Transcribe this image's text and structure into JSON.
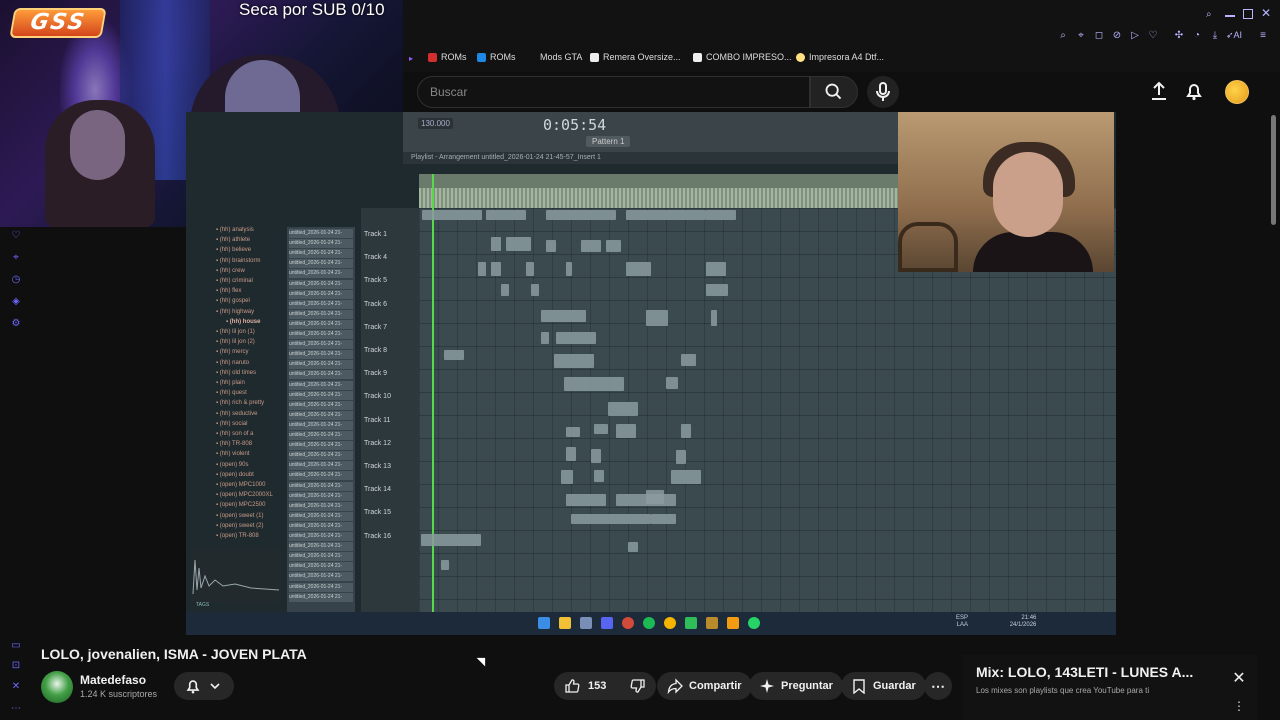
{
  "stream_overlay": {
    "logo_text": "GSS",
    "goal_text": "Seca por SUB 0/10"
  },
  "bookmarks": [
    {
      "label": "ROMs",
      "color": "#d32f2f"
    },
    {
      "label": "ROMs",
      "color": "#1e88e5"
    },
    {
      "label": "Mods GTA",
      "color": "#121212"
    },
    {
      "label": "Remera Oversize...",
      "color": "#fff"
    },
    {
      "label": "COMBO IMPRESO...",
      "color": "#fff"
    },
    {
      "label": "Impresora A4 Dtf...",
      "color": "#ffe082"
    }
  ],
  "header": {
    "search_placeholder": "Buscar",
    "browser_ai_label": "AI"
  },
  "icons": {
    "search": "search-icon",
    "mic": "mic-icon",
    "upload": "upload-icon",
    "bell": "bell-icon",
    "avatar": "avatar"
  },
  "fl_studio": {
    "tempo": "130.000",
    "time": "0:05:54",
    "pattern": "Pattern 1",
    "playlist_title": "Playlist - Arrangement  untitled_2026-01-24 21-45-57_Insert 1",
    "tracks": [
      "Track 1",
      "Track 4",
      "Track 5",
      "Track 6",
      "Track 7",
      "Track 8",
      "Track 9",
      "Track 10",
      "Track 11",
      "Track 12",
      "Track 13",
      "Track 14",
      "Track 15",
      "Track 16"
    ],
    "folders": [
      "(hh) analysis",
      "(hh) athlete",
      "(hh) believe",
      "(hh) brainstorm",
      "(hh) crew",
      "(hh) criminal",
      "(hh) flex",
      "(hh) gospel",
      "(hh) highway",
      "(hh) house",
      "(hh) lil jon (1)",
      "(hh) lil jon (2)",
      "(hh) mercy",
      "(hh) naruto",
      "(hh) old times",
      "(hh) plain",
      "(hh) quest",
      "(hh) rich & pretty",
      "(hh) seductive",
      "(hh) social",
      "(hh) son of a",
      "(hh) TR-808",
      "(hh) violent",
      "(open) 90s",
      "(open) doubt",
      "(open) MPC1000",
      "(open) MPC2000XL",
      "(open) MPC2500",
      "(open) sweet (1)",
      "(open) sweet (2)",
      "(open) TR-808"
    ],
    "file_label": "untitled_2026-01-24 21-",
    "tags_label": "TAGS",
    "tray_lang": "ESP\nLAA",
    "tray_time": "21:46",
    "tray_date": "24/1/2026"
  },
  "video": {
    "title": "LOLO, jovenalien, ISMA - JOVEN PLATA",
    "channel_name": "Matedefaso",
    "subscribers": "1.24 K suscriptores",
    "likes": "153",
    "share_label": "Compartir",
    "ask_label": "Preguntar",
    "save_label": "Guardar"
  },
  "mix": {
    "title": "Mix: LOLO, 143LETI - LUNES A...",
    "subtitle": "Los mixes son playlists que crea YouTube para ti"
  }
}
